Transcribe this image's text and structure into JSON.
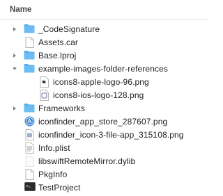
{
  "header": {
    "column_name": "Name"
  },
  "rows": [
    {
      "label": "_CodeSignature",
      "icon": "folder-icon",
      "disclosure": "collapsed"
    },
    {
      "label": "Assets.car",
      "icon": "document-icon",
      "disclosure": "none"
    },
    {
      "label": "Base.lproj",
      "icon": "folder-icon",
      "disclosure": "collapsed"
    },
    {
      "label": "example-images-folder-references",
      "icon": "folder-icon",
      "disclosure": "expanded"
    },
    {
      "label": "icons8-apple-logo-96.png",
      "icon": "image-file-icon",
      "disclosure": "none"
    },
    {
      "label": "icons8-ios-logo-128.png",
      "icon": "image-file-icon",
      "disclosure": "none"
    },
    {
      "label": "Frameworks",
      "icon": "folder-icon",
      "disclosure": "collapsed"
    },
    {
      "label": "iconfinder_app_store_287607.png",
      "icon": "app-store-icon",
      "disclosure": "none"
    },
    {
      "label": "iconfinder_icon-3-file-app_315108.png",
      "icon": "image-file-icon",
      "disclosure": "none"
    },
    {
      "label": "Info.plist",
      "icon": "plist-file-icon",
      "disclosure": "none"
    },
    {
      "label": "libswiftRemoteMirror.dylib",
      "icon": "dylib-file-icon",
      "disclosure": "none"
    },
    {
      "label": "PkgInfo",
      "icon": "document-icon",
      "disclosure": "none"
    },
    {
      "label": "TestProject",
      "icon": "terminal-executable-icon",
      "disclosure": "none"
    }
  ],
  "colors": {
    "folder": "#5ab0ef",
    "disclosure": "#808080",
    "text": "#1d1d1f"
  }
}
